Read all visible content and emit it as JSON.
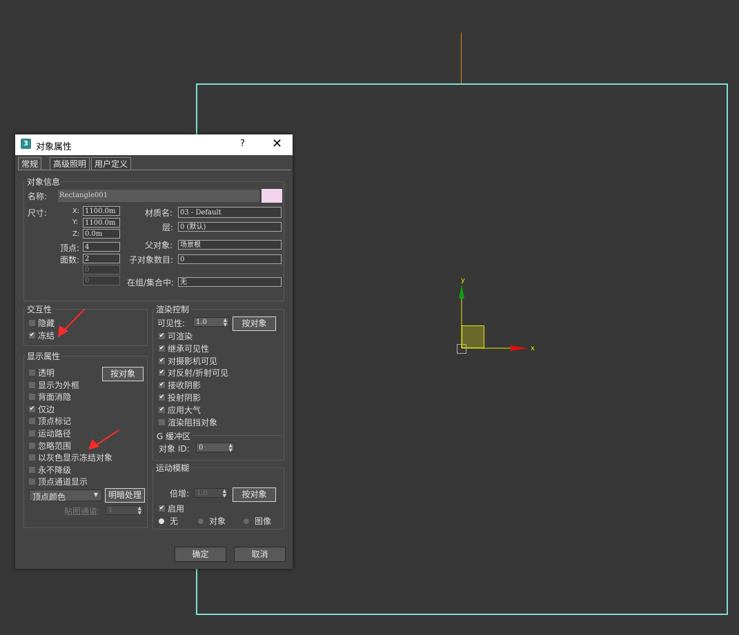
{
  "viewport": {
    "x_axis_label": "x",
    "y_axis_label": "y",
    "colors": {
      "bounding_rect": "#7fe0d2",
      "pivot_line": "#d88a1c",
      "x_axis": "#e6e600",
      "y_axis": "#e6e600",
      "x_arrow": "#e01010",
      "y_arrow": "#10a010"
    }
  },
  "dialog": {
    "title": "对象属性",
    "icon_text": "3",
    "help": "?",
    "close": "✕",
    "tabs": [
      "常规",
      "高级照明",
      "用户定义"
    ],
    "object_info": {
      "group_label": "对象信息",
      "name_label": "名称:",
      "name_value": "Rectangle001",
      "color_swatch": "#f2d4ec",
      "dims_label": "尺寸:",
      "x_label": "X:",
      "x_value": "1100.0m",
      "y_label": "Y:",
      "y_value": "1100.0m",
      "z_label": "Z:",
      "z_value": "0.0m",
      "verts_label": "顶点:",
      "verts_value": "4",
      "faces_label": "面数:",
      "faces_value": "2",
      "extra1_value": "0",
      "extra2_value": "0",
      "material_label": "材质名:",
      "material_value": "03 - Default",
      "layer_label": "层:",
      "layer_value": "0 (默认)",
      "parent_label": "父对象:",
      "parent_value": "场景根",
      "children_label": "子对象数目:",
      "children_value": "0",
      "group_label2": "在组/集合中:",
      "group_value": "无"
    },
    "interactivity": {
      "group_label": "交互性",
      "hide": {
        "label": "隐藏",
        "checked": false
      },
      "freeze": {
        "label": "冻结",
        "checked": true
      }
    },
    "display": {
      "group_label": "显示属性",
      "by_object_btn": "按对象",
      "items": [
        {
          "label": "透明",
          "checked": false
        },
        {
          "label": "显示为外框",
          "checked": false
        },
        {
          "label": "背面消隐",
          "checked": false
        },
        {
          "label": "仅边",
          "checked": true
        },
        {
          "label": "顶点标记",
          "checked": false
        },
        {
          "label": "运动路径",
          "checked": false
        },
        {
          "label": "忽略范围",
          "checked": false
        },
        {
          "label": "以灰色显示冻结对象",
          "checked": false
        },
        {
          "label": "永不降级",
          "checked": false
        },
        {
          "label": "顶点通道显示",
          "checked": false
        }
      ],
      "vertex_color_select": "顶点颜色",
      "shading_btn": "明暗处理",
      "map_channel_label": "贴图通道:",
      "map_channel_value": "1"
    },
    "render": {
      "group_label": "渲染控制",
      "visibility_label": "可见性:",
      "visibility_value": "1.0",
      "by_object_btn": "按对象",
      "items": [
        {
          "label": "可渲染",
          "checked": true
        },
        {
          "label": "继承可见性",
          "checked": true
        },
        {
          "label": "对摄影机可见",
          "checked": true
        },
        {
          "label": "对反射/折射可见",
          "checked": true
        },
        {
          "label": "接收阴影",
          "checked": true
        },
        {
          "label": "投射阴影",
          "checked": true
        },
        {
          "label": "应用大气",
          "checked": true
        },
        {
          "label": "渲染阻挡对象",
          "checked": false
        }
      ],
      "gbuffer_label": "G 缓冲区",
      "object_id_label": "对象 ID:",
      "object_id_value": "0"
    },
    "motion_blur": {
      "group_label": "运动模糊",
      "multiplier_label": "倍增:",
      "multiplier_value": "1.0",
      "by_object_btn": "按对象",
      "enable": {
        "label": "启用",
        "checked": true
      },
      "radios": [
        {
          "label": "无",
          "selected": true
        },
        {
          "label": "对象",
          "selected": false
        },
        {
          "label": "图像",
          "selected": false
        }
      ]
    },
    "ok": "确定",
    "cancel": "取消"
  }
}
